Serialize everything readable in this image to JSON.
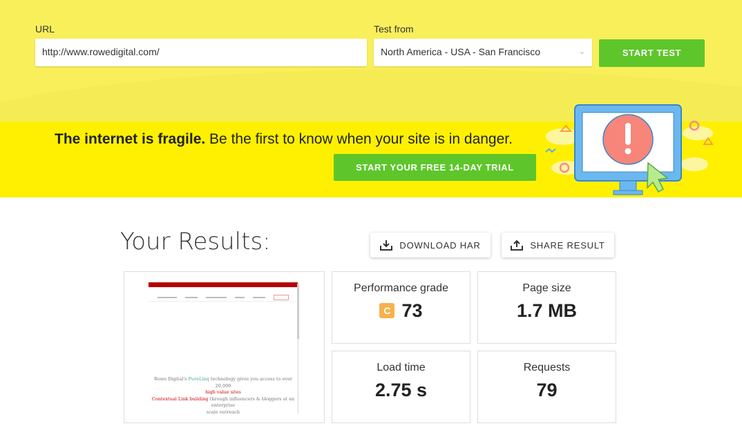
{
  "form": {
    "url_label": "URL",
    "url_value": "http://www.rowedigital.com/",
    "test_from_label": "Test from",
    "test_from_value": "North America - USA - San Francisco",
    "start_label": "START TEST"
  },
  "banner": {
    "bold": "The internet is fragile.",
    "text": " Be the first to know when your site is in danger.",
    "trial_label": "START YOUR FREE 14-DAY TRIAL"
  },
  "results": {
    "title": "Your Results:",
    "download_label": "DOWNLOAD HAR",
    "share_label": "SHARE RESULT",
    "grade_label": "Performance grade",
    "grade_letter": "C",
    "grade_value": "73",
    "size_label": "Page size",
    "size_value": "1.7 MB",
    "load_label": "Load time",
    "load_value": "2.75 s",
    "requests_label": "Requests",
    "requests_value": "79"
  },
  "thumbnail": {
    "line1a": "Rowe Digital's ",
    "line1b": "PureLinq",
    "line1c": " technology gives you access to over 20,000",
    "line2": "high value sites",
    "line3a": "Contextual Link building",
    "line3b": " through influencers & bloggers at an enterprise",
    "line4": "scale outreach"
  },
  "colors": {
    "yellow": "#f9ef5b",
    "banner": "#fef000",
    "green": "#5ec62b",
    "grade": "#f6b24d"
  }
}
